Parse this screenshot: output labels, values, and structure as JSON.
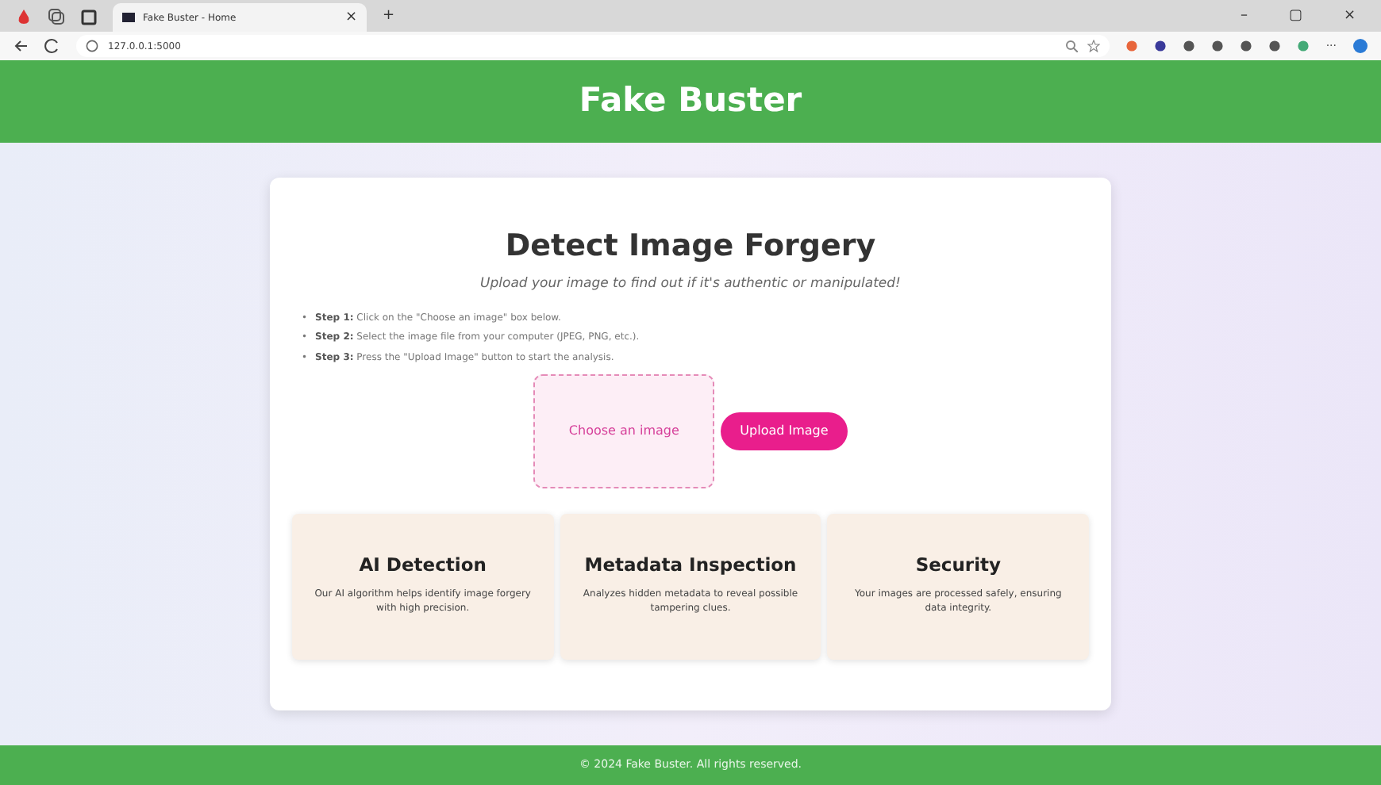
{
  "browser": {
    "tab_title": "Fake Buster - Home",
    "tab_close": "×",
    "new_tab": "+",
    "url": "127.0.0.1:5000",
    "window_controls": [
      "–",
      "▢",
      "×"
    ],
    "menu": "···"
  },
  "header": {
    "title": "Fake Buster"
  },
  "main": {
    "title": "Detect Image Forgery",
    "subtitle": "Upload your image to find out if it's authentic or manipulated!",
    "steps": [
      {
        "bullet": "•",
        "text": "**Step 1:** Click on the \"Choose an image\" box below."
      },
      {
        "bullet": "•",
        "text": "**Step 2:** Select the image file from your computer (JPEG, PNG, etc.)."
      },
      {
        "bullet": "•",
        "text": "**Step 3:** Press the \"Upload Image\" button to start the analysis."
      }
    ],
    "choose_label": "Choose an image",
    "upload_button": "Upload Image"
  },
  "features": [
    {
      "title": "AI Detection",
      "text": "Our AI algorithm helps identify image forgery with high precision."
    },
    {
      "title": "Metadata Inspection",
      "text": "Analyzes hidden metadata to reveal possible tampering clues."
    },
    {
      "title": "Security",
      "text": "Your images are processed safely, ensuring data integrity."
    }
  ],
  "footer": {
    "text": "© 2024 Fake Buster. All rights reserved."
  }
}
